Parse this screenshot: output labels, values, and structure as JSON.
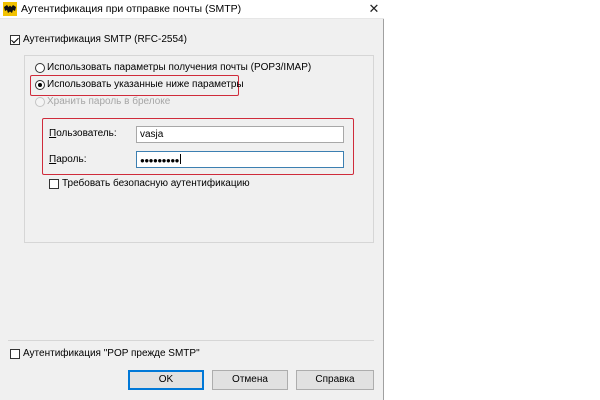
{
  "window": {
    "title": "Аутентификация при отправке почты (SMTP)",
    "close_glyph": "✕"
  },
  "smtp_auth": {
    "label": "Аутентификация SMTP (RFC-2554)",
    "checked": true
  },
  "options": {
    "use_receive_params": {
      "label": "Использовать параметры получения почты (POP3/IMAP)",
      "selected": false
    },
    "use_below_params": {
      "label": "Использовать указанные ниже параметры",
      "selected": true
    },
    "store_in_keychain": {
      "label": "Хранить пароль в брелоке",
      "enabled": false
    }
  },
  "credentials": {
    "user_label": "Пользователь:",
    "user_value": "vasja",
    "password_label": "Пароль:",
    "password_value": "●●●●●●●●●"
  },
  "secure_auth": {
    "label": "Требовать безопасную аутентификацию",
    "checked": false
  },
  "pop_before_smtp": {
    "label": "Аутентификация \"POP прежде SMTP\"",
    "checked": false
  },
  "buttons": {
    "ok": "OK",
    "cancel": "Отмена",
    "help": "Справка"
  },
  "colors": {
    "highlight": "#cf2b3b",
    "focus_border": "#3c7fb1",
    "default_button_border": "#0078d7"
  }
}
